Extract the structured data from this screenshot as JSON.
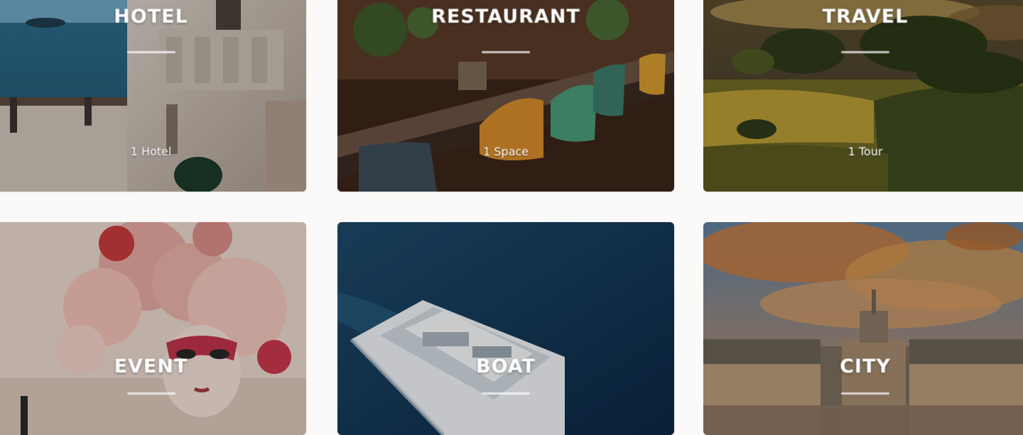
{
  "categories": [
    {
      "id": "hotel",
      "title": "HOTEL",
      "count": "1 Hotel"
    },
    {
      "id": "restaurant",
      "title": "RESTAURANT",
      "count": "1 Space"
    },
    {
      "id": "travel",
      "title": "TRAVEL",
      "count": "1 Tour"
    },
    {
      "id": "event",
      "title": "EVENT"
    },
    {
      "id": "boat",
      "title": "BOAT"
    },
    {
      "id": "city",
      "title": "CITY"
    }
  ]
}
